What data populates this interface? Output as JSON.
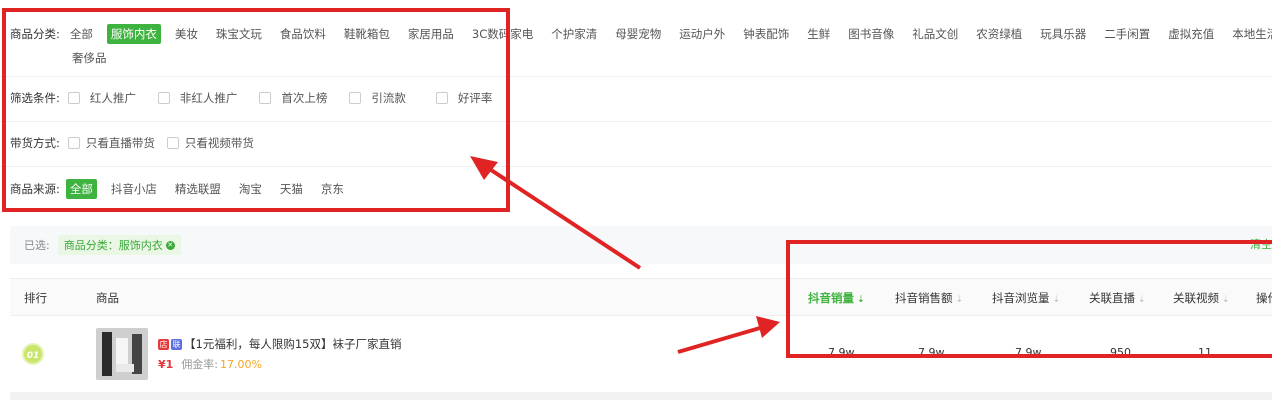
{
  "filters": {
    "category": {
      "label": "商品分类:",
      "items": [
        "全部",
        "服饰内衣",
        "美妆",
        "珠宝文玩",
        "食品饮料",
        "鞋靴箱包",
        "家居用品",
        "3C数码家电",
        "个护家清",
        "母婴宠物",
        "运动户外",
        "钟表配饰",
        "生鲜",
        "图书音像",
        "礼品文创",
        "农资绿植",
        "玩具乐器",
        "二手闲置",
        "虚拟充值",
        "本地生活"
      ],
      "second_line": "奢侈品",
      "active_index": 1
    },
    "conditions": {
      "label": "筛选条件:",
      "items": [
        "红人推广",
        "非红人推广",
        "首次上榜",
        "引流款",
        "好评率"
      ]
    },
    "delivery": {
      "label": "带货方式:",
      "items": [
        "只看直播带货",
        "只看视频带货"
      ]
    },
    "source": {
      "label": "商品来源:",
      "items": [
        "全部",
        "抖音小店",
        "精选联盟",
        "淘宝",
        "天猫",
        "京东"
      ],
      "active_index": 0
    }
  },
  "selected": {
    "label": "已选:",
    "chip": "商品分类：服饰内衣",
    "clear": "清空"
  },
  "table": {
    "headers": {
      "rank": "排行",
      "product": "商品",
      "sales": "抖音销量",
      "revenue": "抖音销售额",
      "views": "抖音浏览量",
      "live": "关联直播",
      "video": "关联视频",
      "action": "操作"
    },
    "rows": [
      {
        "rank": "01",
        "title": "【1元福利，每人限购15双】袜子厂家直销",
        "price": "¥1",
        "commission_label": "佣金率:",
        "commission": "17.00%",
        "sales": "7.9w",
        "revenue": "7.9w",
        "views": "7.9w",
        "live": "950",
        "video": "11"
      }
    ]
  },
  "colors": {
    "accent": "#3fb33f",
    "annotation": "#e02424",
    "price": "#e4393c",
    "commission": "#f5a623"
  }
}
